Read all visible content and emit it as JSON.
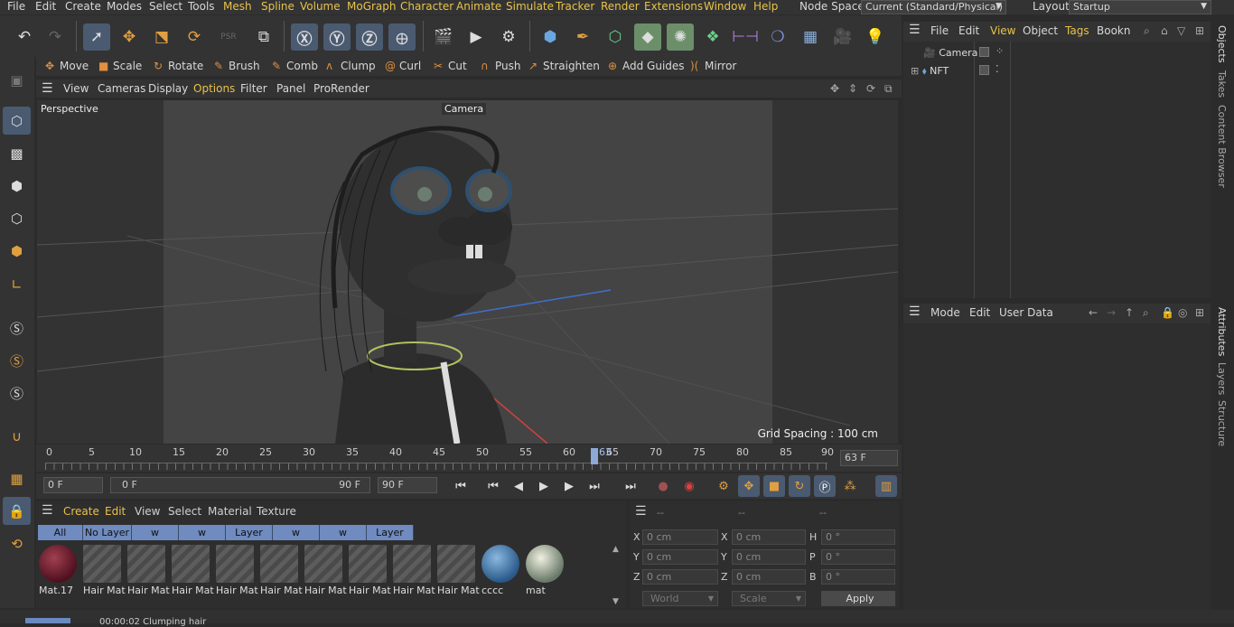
{
  "menubar": {
    "items": [
      "File",
      "Edit",
      "Create",
      "Modes",
      "Select",
      "Tools",
      "Mesh",
      "Spline",
      "Volume",
      "MoGraph",
      "Character",
      "Animate",
      "Simulate",
      "Tracker",
      "Render",
      "Extensions",
      "Window",
      "Help"
    ],
    "node_space_label": "Node Space:",
    "node_space_value": "Current (Standard/Physical)",
    "layout_label": "Layout:",
    "layout_value": "Startup"
  },
  "toolbar": {
    "icons": [
      "undo-icon",
      "redo-icon",
      "select-cursor-icon",
      "move-icon",
      "scale-icon",
      "rotate-icon",
      "psr-icon",
      "last-tool-icon",
      "x-axis-icon",
      "y-axis-icon",
      "z-axis-icon",
      "world-coord-icon",
      "render-view-icon",
      "render-picture-icon",
      "render-settings-icon",
      "cube-icon",
      "pen-icon",
      "subdivision-icon",
      "extrude-icon",
      "cloner-icon",
      "voronoi-icon",
      "symmetry-icon",
      "deformer-icon",
      "floor-icon",
      "camera-icon",
      "light-icon"
    ]
  },
  "modebar": {
    "items": [
      "Move",
      "Scale",
      "Rotate",
      "Brush",
      "Comb",
      "Clump",
      "Curl",
      "Cut",
      "Push",
      "Straighten",
      "Add Guides",
      "Mirror"
    ]
  },
  "viewport_menu": {
    "items": [
      "View",
      "Cameras",
      "Display",
      "Options",
      "Filter",
      "Panel",
      "ProRender"
    ],
    "perspective_label": "Perspective",
    "camera_label": "Camera",
    "grid_spacing": "Grid Spacing : 100 cm"
  },
  "timeline": {
    "ticks": [
      "0",
      "5",
      "10",
      "15",
      "20",
      "25",
      "30",
      "35",
      "40",
      "45",
      "50",
      "55",
      "60",
      "65",
      "70",
      "75",
      "80",
      "85",
      "90"
    ],
    "current_marker": "63",
    "current_frame_field": "63 F"
  },
  "playbar": {
    "start_field": "0 F",
    "range_start": "0 F",
    "range_end": "90 F",
    "end_field": "90 F"
  },
  "material_panel": {
    "menu": [
      "Create",
      "Edit",
      "View",
      "Select",
      "Material",
      "Texture"
    ],
    "tabs": [
      "All",
      "No Layer",
      "w",
      "w",
      "Layer",
      "w",
      "w",
      "Layer"
    ],
    "materials": [
      {
        "name": "Mat.17"
      },
      {
        "name": "Hair Mat"
      },
      {
        "name": "Hair Mat"
      },
      {
        "name": "Hair Mat"
      },
      {
        "name": "Hair Mat"
      },
      {
        "name": "Hair Mat"
      },
      {
        "name": "Hair Mat"
      },
      {
        "name": "Hair Mat"
      },
      {
        "name": "Hair Mat"
      },
      {
        "name": "Hair Mat"
      },
      {
        "name": "cccc"
      },
      {
        "name": "mat"
      }
    ]
  },
  "coord_panel": {
    "header": [
      "--",
      "--",
      "--"
    ],
    "rows": [
      {
        "a": "X",
        "av": "0 cm",
        "b": "X",
        "bv": "0 cm",
        "c": "H",
        "cv": "0 °"
      },
      {
        "a": "Y",
        "av": "0 cm",
        "b": "Y",
        "bv": "0 cm",
        "c": "P",
        "cv": "0 °"
      },
      {
        "a": "Z",
        "av": "0 cm",
        "b": "Z",
        "bv": "0 cm",
        "c": "B",
        "cv": "0 °"
      }
    ],
    "world": "World",
    "scale": "Scale",
    "apply": "Apply"
  },
  "objects_panel": {
    "menu": [
      "File",
      "Edit",
      "View",
      "Object",
      "Tags",
      "Bookn"
    ],
    "objects": [
      {
        "name": "Camera"
      },
      {
        "name": "NFT"
      }
    ]
  },
  "attributes_panel": {
    "menu": [
      "Mode",
      "Edit",
      "User Data"
    ]
  },
  "right_tabs": [
    "Objects",
    "Takes",
    "Content Browser",
    "Attributes",
    "Layers",
    "Structure"
  ],
  "status": {
    "text": "00:00:02 Clumping hair"
  },
  "colors": {
    "accent": "#e8c24a",
    "selected_tool": "#4a5a70",
    "tab_blue": "#6f8bbf"
  }
}
